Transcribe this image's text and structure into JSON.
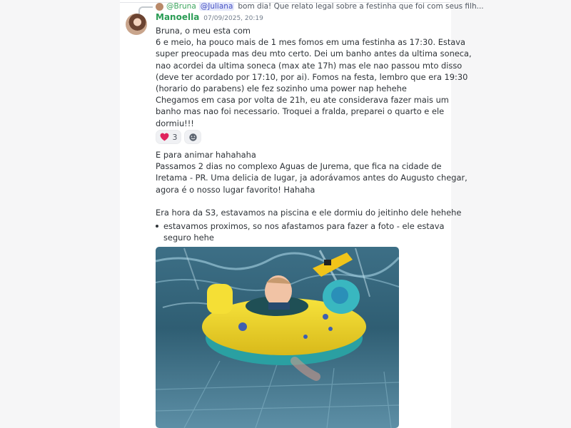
{
  "reply": {
    "author": "@Bruna",
    "mention": "@Juliana",
    "text": "bom dia!  Que relato legal sobre a festinha que foi com seus filh..."
  },
  "message": {
    "author": "Manoella",
    "timestamp": "07/09/2025, 20:19",
    "paragraph1": [
      "Bruna, o meu esta com",
      "6 e meio, ha pouco mais de 1 mes fomos em uma festinha as 17:30. Estava",
      "super preocupada mas deu mto certo. Dei um banho antes da ultima soneca,",
      "nao acordei da ultima soneca (max ate 17h) mas ele nao passou mto disso",
      "(deve ter acordado por 17:10, por ai). Fomos na festa, lembro que era 19:30",
      "(horario do parabens) ele fez sozinho uma power nap hehehe",
      "Chegamos em casa por volta de 21h, eu ate considerava fazer mais um",
      "banho mas nao foi necessario. Troquei a fralda, preparei o quarto e ele",
      "dormiu!!!"
    ],
    "reactions": [
      {
        "emoji": "heart-icon",
        "count": "3"
      },
      {
        "emoji": "add-reaction-icon"
      }
    ],
    "paragraph2": [
      "E para animar hahahaha",
      "Passamos 2 dias no complexo Aguas de Jurema, que fica na cidade de",
      "Iretama - PR. Uma delicia de lugar, ja adorávamos antes do Augusto chegar,",
      "agora é o nosso lugar favorito! Hahaha"
    ],
    "paragraph3": "Era hora da S3, estavamos na piscina e ele dormiu do jeitinho dele hehehe",
    "bullet": [
      "estavamos proximos, so nos afastamos para fazer a foto - ele estava",
      "seguro hehe"
    ]
  },
  "colors": {
    "author": "#2b9c55",
    "mention_bg": "#e3e7fb",
    "mention_text": "#4752c4",
    "heart": "#e0245e"
  }
}
